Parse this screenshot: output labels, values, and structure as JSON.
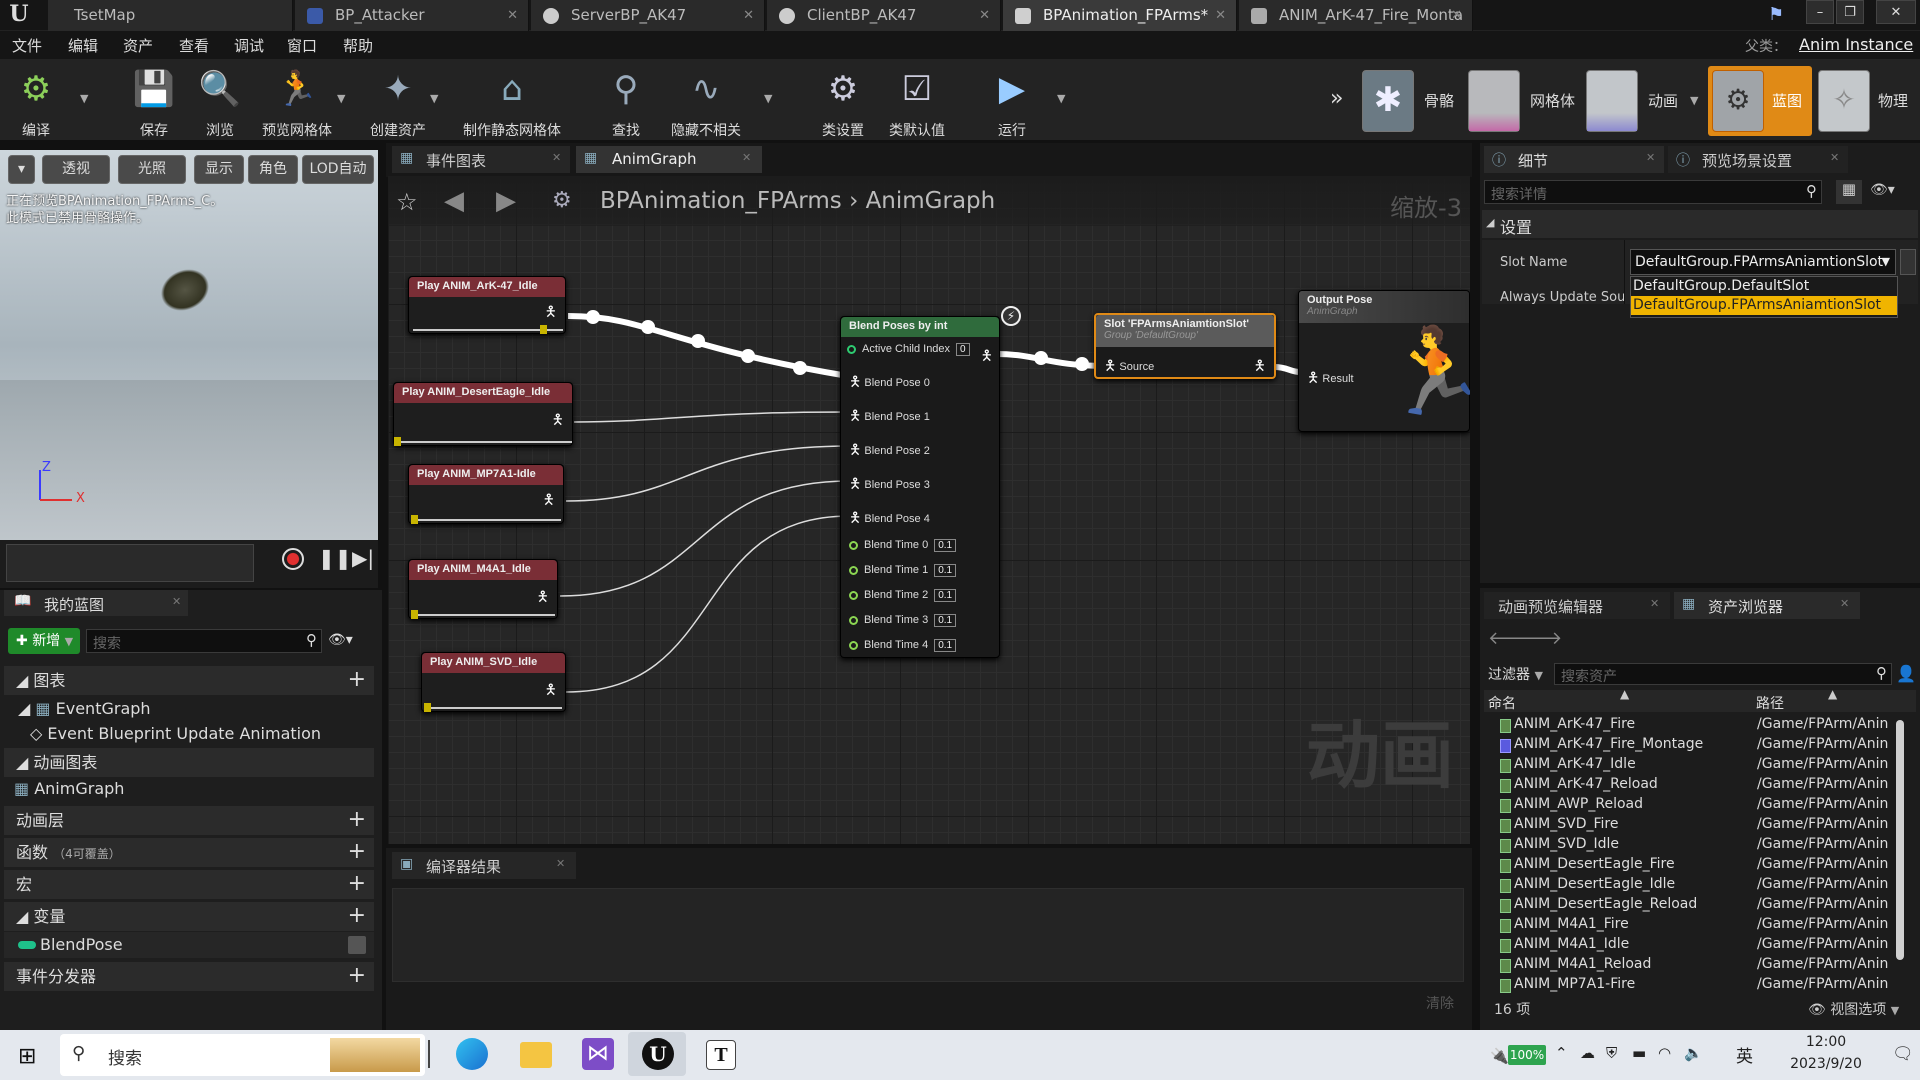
{
  "window": {
    "controls": {
      "min": "–",
      "max": "❐",
      "close": "✕"
    }
  },
  "tabs": [
    {
      "label": "TsetMap"
    },
    {
      "label": "BP_Attacker"
    },
    {
      "label": "ServerBP_AK47"
    },
    {
      "label": "ClientBP_AK47"
    },
    {
      "label": "BPAnimation_FPArms*"
    },
    {
      "label": "ANIM_ArK-47_Fire_Monta"
    }
  ],
  "menubar": {
    "items": [
      "文件",
      "编辑",
      "资产",
      "查看",
      "调试",
      "窗口",
      "帮助"
    ],
    "parent_label": "父类：",
    "parent_value": "Anim Instance"
  },
  "toolbar": {
    "items": [
      {
        "label": "编译",
        "icon": "compile-icon"
      },
      {
        "label": "保存",
        "icon": "save-icon"
      },
      {
        "label": "浏览",
        "icon": "browse-icon"
      },
      {
        "label": "预览网格体",
        "icon": "preview-mesh-icon"
      },
      {
        "label": "创建资产",
        "icon": "create-asset-icon"
      },
      {
        "label": "制作静态网格体",
        "icon": "static-mesh-icon"
      },
      {
        "label": "查找",
        "icon": "find-icon"
      },
      {
        "label": "隐藏不相关",
        "icon": "hide-unrelated-icon"
      },
      {
        "label": "类设置",
        "icon": "class-settings-icon"
      },
      {
        "label": "类默认值",
        "icon": "class-defaults-icon"
      },
      {
        "label": "运行",
        "icon": "play-icon"
      }
    ],
    "modes": [
      {
        "label": "骨骼"
      },
      {
        "label": "网格体"
      },
      {
        "label": "动画"
      },
      {
        "label": "蓝图"
      },
      {
        "label": "物理"
      }
    ]
  },
  "viewport": {
    "buttons": [
      "透视",
      "光照",
      "显示",
      "角色",
      "LOD自动"
    ],
    "overlay_line1": "正在预览BPAnimation_FPArms_C。",
    "overlay_line2": "此模式已禁用骨骼操作。",
    "axis_z": "Z",
    "axis_x": "X"
  },
  "my_blueprint": {
    "title": "我的蓝图",
    "new_button": "新增",
    "search_placeholder": "搜索",
    "sections": {
      "graphs": "图表",
      "event_graph": "EventGraph",
      "event_bp_update": "Event Blueprint Update Animation",
      "anim_graphs": "动画图表",
      "anim_graph": "AnimGraph",
      "anim_layers": "动画层",
      "functions": "函数",
      "functions_note": "（4可覆盖）",
      "macros": "宏",
      "variables": "变量",
      "blend_pose_var": "BlendPose",
      "event_dispatchers": "事件分发器"
    }
  },
  "graph_tabs": {
    "event_graph": "事件图表",
    "anim_graph": "AnimGraph"
  },
  "breadcrumb": {
    "root": "BPAnimation_FPArms",
    "sep": "›",
    "leaf": "AnimGraph",
    "zoom": "缩放-3"
  },
  "nodes": {
    "play_nodes": [
      "Play ANIM_ArK-47_Idle",
      "Play ANIM_DesertEagle_Idle",
      "Play ANIM_MP7A1-Idle",
      "Play ANIM_M4A1_Idle",
      "Play ANIM_SVD_Idle"
    ],
    "blend": {
      "title": "Blend Poses by int",
      "active_child_index": "Active Child Index",
      "active_child_value": "0",
      "poses": [
        "Blend Pose 0",
        "Blend Pose 1",
        "Blend Pose 2",
        "Blend Pose 3",
        "Blend Pose 4"
      ],
      "times": [
        {
          "label": "Blend Time 0",
          "value": "0.1"
        },
        {
          "label": "Blend Time 1",
          "value": "0.1"
        },
        {
          "label": "Blend Time 2",
          "value": "0.1"
        },
        {
          "label": "Blend Time 3",
          "value": "0.1"
        },
        {
          "label": "Blend Time 4",
          "value": "0.1"
        }
      ]
    },
    "slot": {
      "title": "Slot 'FPArmsAniamtionSlot'",
      "subtitle": "Group 'DefaultGroup'",
      "pin": "Source"
    },
    "output": {
      "title": "Output Pose",
      "subtitle": "AnimGraph",
      "pin": "Result"
    }
  },
  "graph_watermark": "动画",
  "compiler": {
    "title": "编译器结果",
    "clear": "清除"
  },
  "details": {
    "tab_details": "细节",
    "tab_preview": "预览场景设置",
    "search_placeholder": "搜索详情",
    "section": "设置",
    "slot_name_label": "Slot Name",
    "slot_name_value": "DefaultGroup.FPArmsAniamtionSlot",
    "always_update_label": "Always Update Source",
    "dropdown_options": [
      "DefaultGroup.DefaultSlot",
      "DefaultGroup.FPArmsAniamtionSlot"
    ],
    "selected_option": 1
  },
  "asset_browser": {
    "tab_preview_editor": "动画预览编辑器",
    "tab_asset_browser": "资产浏览器",
    "filter_label": "过滤器",
    "search_placeholder": "搜索资产",
    "col_name": "命名",
    "col_path": "路径",
    "rows": [
      {
        "name": "ANIM_ArK-47_Fire",
        "path": "/Game/FPArm/Anin",
        "kind": "anim"
      },
      {
        "name": "ANIM_ArK-47_Fire_Montage",
        "path": "/Game/FPArm/Anin",
        "kind": "montage"
      },
      {
        "name": "ANIM_ArK-47_Idle",
        "path": "/Game/FPArm/Anin",
        "kind": "anim"
      },
      {
        "name": "ANIM_ArK-47_Reload",
        "path": "/Game/FPArm/Anin",
        "kind": "anim"
      },
      {
        "name": "ANIM_AWP_Reload",
        "path": "/Game/FPArm/Anin",
        "kind": "anim"
      },
      {
        "name": "ANIM_SVD_Fire",
        "path": "/Game/FPArm/Anin",
        "kind": "anim"
      },
      {
        "name": "ANIM_SVD_Idle",
        "path": "/Game/FPArm/Anin",
        "kind": "anim"
      },
      {
        "name": "ANIM_DesertEagle_Fire",
        "path": "/Game/FPArm/Anin",
        "kind": "anim"
      },
      {
        "name": "ANIM_DesertEagle_Idle",
        "path": "/Game/FPArm/Anin",
        "kind": "anim"
      },
      {
        "name": "ANIM_DesertEagle_Reload",
        "path": "/Game/FPArm/Anin",
        "kind": "anim"
      },
      {
        "name": "ANIM_M4A1_Fire",
        "path": "/Game/FPArm/Anin",
        "kind": "anim"
      },
      {
        "name": "ANIM_M4A1_Idle",
        "path": "/Game/FPArm/Anin",
        "kind": "anim"
      },
      {
        "name": "ANIM_M4A1_Reload",
        "path": "/Game/FPArm/Anin",
        "kind": "anim"
      },
      {
        "name": "ANIM_MP7A1-Fire",
        "path": "/Game/FPArm/Anin",
        "kind": "anim"
      }
    ],
    "count": "16 项",
    "view_options": "视图选项"
  },
  "taskbar": {
    "search": "搜索",
    "battery": "100%",
    "ime": "英",
    "time": "12:00",
    "date": "2023/9/20"
  },
  "colors": {
    "accent_orange": "#e08a16",
    "play_node_header": "#7a2e36",
    "blend_header": "#2f6b3c",
    "dropdown_selected": "#f0b400"
  }
}
